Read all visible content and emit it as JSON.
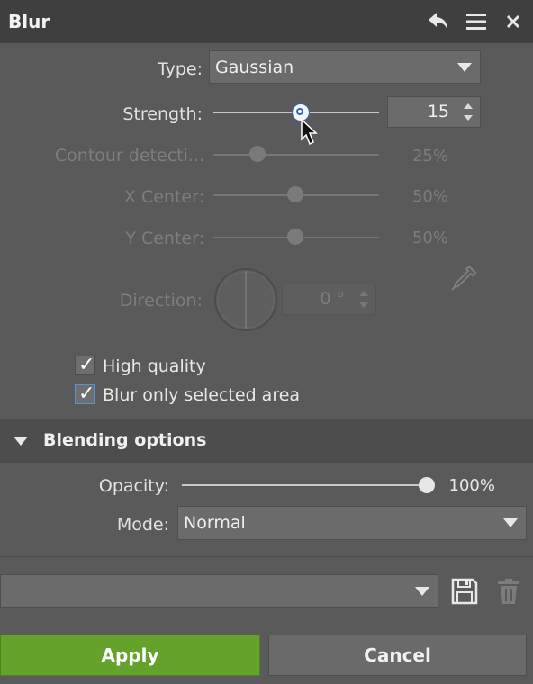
{
  "panel": {
    "title": "Blur",
    "icons": {
      "undo": "undo-arrow-icon",
      "menu": "hamburger-menu-icon",
      "close": "close-icon"
    }
  },
  "type": {
    "label": "Type:",
    "value": "Gaussian"
  },
  "strength": {
    "label": "Strength:",
    "value": "15",
    "slider_fraction": 0.5
  },
  "contour": {
    "label": "Contour detecti...",
    "value": "25%",
    "slider_fraction": 0.25
  },
  "x_center": {
    "label": "X Center:",
    "value": "50%",
    "slider_fraction": 0.5
  },
  "y_center": {
    "label": "Y Center:",
    "value": "50%",
    "slider_fraction": 0.5
  },
  "direction": {
    "label": "Direction:",
    "value": "0 °",
    "picker_icon": "eyedropper-icon"
  },
  "checkboxes": [
    {
      "label": "High quality",
      "checked": true
    },
    {
      "label": "Blur only selected area",
      "checked": true
    }
  ],
  "blending": {
    "title": "Blending options",
    "opacity": {
      "label": "Opacity:",
      "value": "100%",
      "slider_fraction": 1.0
    },
    "mode": {
      "label": "Mode:",
      "value": "Normal"
    }
  },
  "preset": {
    "value": "",
    "save_icon": "save-disk-icon",
    "delete_icon": "trash-icon"
  },
  "buttons": {
    "apply": "Apply",
    "cancel": "Cancel"
  },
  "colors": {
    "accent": "#65a22c",
    "focus": "#2f66b8"
  }
}
